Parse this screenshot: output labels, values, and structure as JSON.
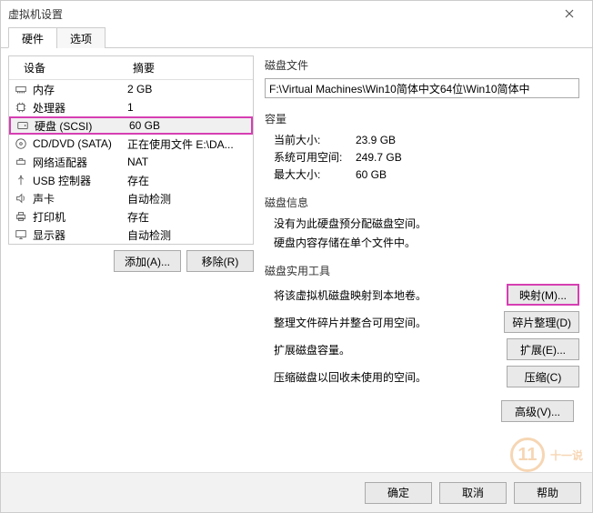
{
  "window": {
    "title": "虚拟机设置"
  },
  "tabs": [
    {
      "label": "硬件",
      "active": true
    },
    {
      "label": "选项",
      "active": false
    }
  ],
  "left": {
    "col_device": "设备",
    "col_summary": "摘要",
    "rows": [
      {
        "icon": "memory-icon",
        "name": "内存",
        "value": "2 GB"
      },
      {
        "icon": "cpu-icon",
        "name": "处理器",
        "value": "1"
      },
      {
        "icon": "hdd-icon",
        "name": "硬盘 (SCSI)",
        "value": "60 GB",
        "selected": true,
        "highlight": true
      },
      {
        "icon": "disc-icon",
        "name": "CD/DVD (SATA)",
        "value": "正在使用文件 E:\\DA..."
      },
      {
        "icon": "net-icon",
        "name": "网络适配器",
        "value": "NAT"
      },
      {
        "icon": "usb-icon",
        "name": "USB 控制器",
        "value": "存在"
      },
      {
        "icon": "sound-icon",
        "name": "声卡",
        "value": "自动检测"
      },
      {
        "icon": "printer-icon",
        "name": "打印机",
        "value": "存在"
      },
      {
        "icon": "display-icon",
        "name": "显示器",
        "value": "自动检测"
      }
    ],
    "add_btn": "添加(A)...",
    "remove_btn": "移除(R)"
  },
  "right": {
    "disk_file_label": "磁盘文件",
    "disk_file_value": "F:\\Virtual Machines\\Win10简体中文64位\\Win10简体中",
    "capacity_label": "容量",
    "current_size_k": "当前大小:",
    "current_size_v": "23.9 GB",
    "free_space_k": "系统可用空间:",
    "free_space_v": "249.7 GB",
    "max_size_k": "最大大小:",
    "max_size_v": "60 GB",
    "disk_info_label": "磁盘信息",
    "disk_info_line1": "没有为此硬盘预分配磁盘空间。",
    "disk_info_line2": "硬盘内容存储在单个文件中。",
    "tools_label": "磁盘实用工具",
    "map_desc": "将该虚拟机磁盘映射到本地卷。",
    "map_btn": "映射(M)...",
    "defrag_desc": "整理文件碎片并整合可用空间。",
    "defrag_btn": "碎片整理(D)",
    "expand_desc": "扩展磁盘容量。",
    "expand_btn": "扩展(E)...",
    "compact_desc": "压缩磁盘以回收未使用的空间。",
    "compact_btn": "压缩(C)",
    "advanced_btn": "高级(V)..."
  },
  "footer": {
    "ok": "确定",
    "cancel": "取消",
    "help": "帮助"
  },
  "watermark": {
    "num": "11",
    "text": "十一说"
  }
}
